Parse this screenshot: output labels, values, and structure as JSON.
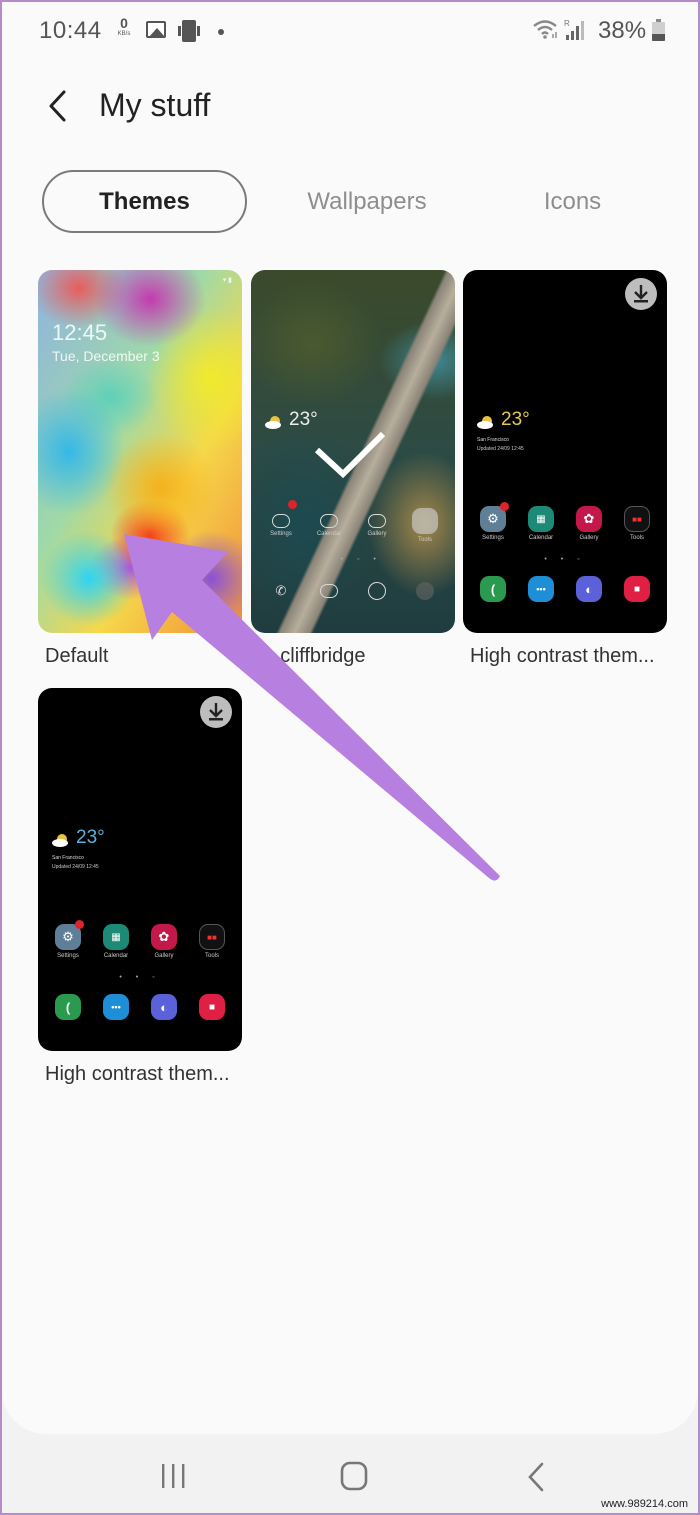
{
  "status_bar": {
    "time": "10:44",
    "net_speed_value": "0",
    "net_speed_unit": "KB/s",
    "icons": [
      "gallery-notification-icon",
      "sim-icon",
      "notification-dot-icon",
      "wifi-icon",
      "signal-icon",
      "battery-icon"
    ],
    "battery_percent_label": "38%",
    "battery_level": 0.38
  },
  "header": {
    "back_icon": "chevron-left-icon",
    "title": "My stuff"
  },
  "tabs": [
    {
      "label": "Themes",
      "active": true
    },
    {
      "label": "Wallpapers",
      "active": false
    },
    {
      "label": "Icons",
      "active": false
    }
  ],
  "themes": [
    {
      "name": "Default",
      "preview": {
        "time": "12:45",
        "date": "Tue, December 3"
      },
      "selected": false,
      "downloadable": false
    },
    {
      "name": "...cliffbridge",
      "visible_name": "cliffbridge",
      "preview": {
        "temperature": "23°",
        "apps": [
          "Settings",
          "Calendar",
          "Gallery",
          "Tools"
        ]
      },
      "selected": true,
      "downloadable": false
    },
    {
      "name": "High contrast them...",
      "preview": {
        "temperature": "23°",
        "city": "San Francisco",
        "updated": "Updated 24/09 12:45",
        "apps": [
          "Settings",
          "Calendar",
          "Gallery",
          "Tools"
        ]
      },
      "selected": false,
      "downloadable": true
    },
    {
      "name": "High contrast them...",
      "preview": {
        "temperature": "23°",
        "city": "San Francisco",
        "updated": "Updated 24/09 12:45",
        "apps": [
          "Settings",
          "Calendar",
          "Gallery",
          "Tools"
        ]
      },
      "selected": false,
      "downloadable": true
    }
  ],
  "colors": {
    "annotation_arrow": "#b77fe0",
    "temp_gold": "#e6c84a",
    "temp_blue": "#5fb0dc",
    "badge_red": "#e0232a"
  },
  "nav_bar": {
    "recents_icon": "recents-icon",
    "home_icon": "home-icon",
    "back_icon": "back-icon"
  },
  "watermark": "www.989214.com"
}
